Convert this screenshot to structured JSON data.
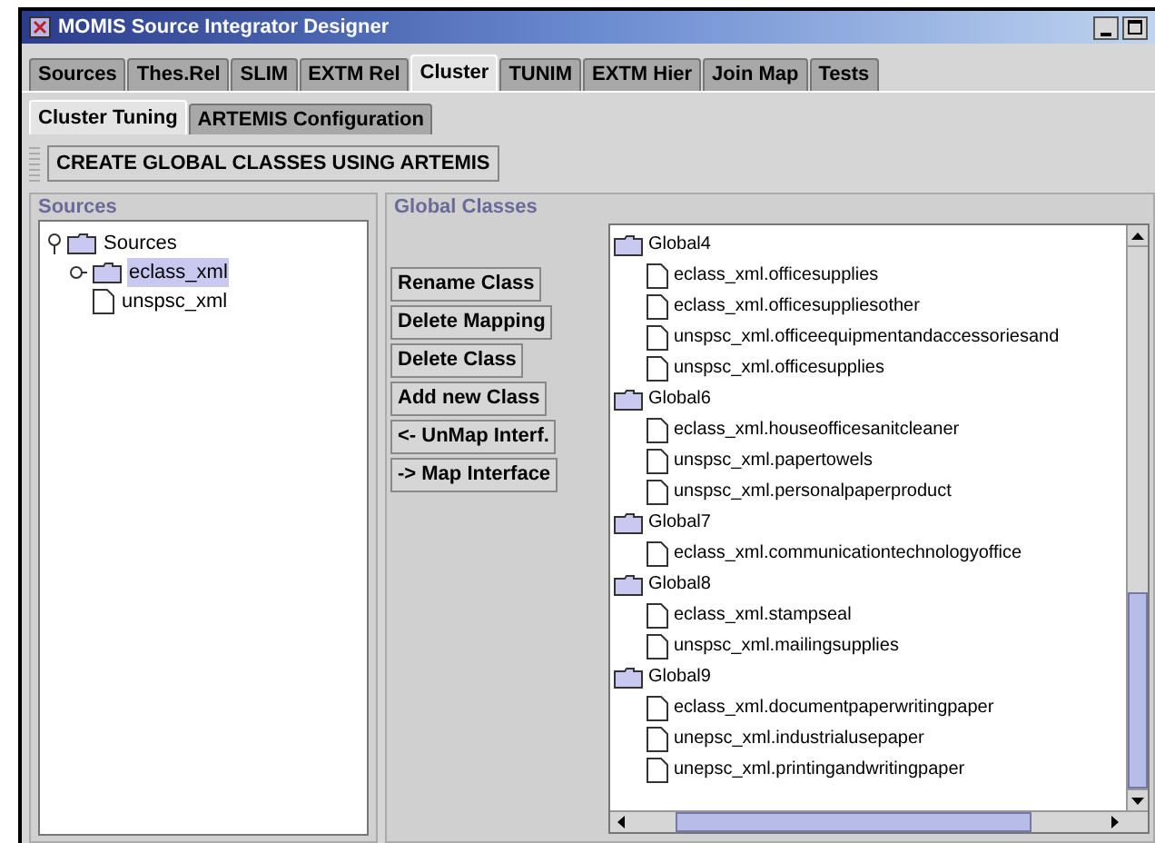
{
  "window": {
    "title": "MOMIS Source Integrator Designer"
  },
  "tabs": [
    {
      "label": "Sources",
      "selected": false
    },
    {
      "label": "Thes.Rel",
      "selected": false
    },
    {
      "label": "SLIM",
      "selected": false
    },
    {
      "label": "EXTM Rel",
      "selected": false
    },
    {
      "label": "Cluster",
      "selected": true
    },
    {
      "label": "TUNIM",
      "selected": false
    },
    {
      "label": "EXTM Hier",
      "selected": false
    },
    {
      "label": "Join Map",
      "selected": false
    },
    {
      "label": "Tests",
      "selected": false
    }
  ],
  "subtabs": [
    {
      "label": "Cluster Tuning",
      "selected": true
    },
    {
      "label": "ARTEMIS Configuration",
      "selected": false
    }
  ],
  "toolbar": {
    "button": "CREATE GLOBAL CLASSES USING ARTEMIS"
  },
  "sources_panel": {
    "title": "Sources",
    "tree": [
      {
        "label": "Sources",
        "expanded": true,
        "selected": false,
        "children": [
          {
            "label": "eclass_xml",
            "kind": "folder",
            "selected": true
          },
          {
            "label": "unspsc_xml",
            "kind": "file",
            "selected": false
          }
        ]
      }
    ]
  },
  "global_panel": {
    "title": "Global Classes",
    "buttons": [
      "Rename Class",
      "Delete Mapping",
      "Delete Class",
      "Add new Class",
      "<- UnMap Interf.",
      "-> Map Interface"
    ],
    "tree": [
      {
        "label": "Global4",
        "children": [
          "eclass_xml.officesupplies",
          "eclass_xml.officesuppliesother",
          "unspsc_xml.officeequipmentandaccessoriesand",
          "unspsc_xml.officesupplies"
        ]
      },
      {
        "label": "Global6",
        "children": [
          "eclass_xml.houseofficesanitcleaner",
          "unspsc_xml.papertowels",
          "unspsc_xml.personalpaperproduct"
        ]
      },
      {
        "label": "Global7",
        "children": [
          "eclass_xml.communicationtechnologyoffice"
        ]
      },
      {
        "label": "Global8",
        "children": [
          "eclass_xml.stampseal",
          "unspsc_xml.mailingsupplies"
        ]
      },
      {
        "label": "Global9",
        "children": [
          "eclass_xml.documentpaperwritingpaper",
          "unepsc_xml.industrialusepaper",
          "unepsc_xml.printingandwritingpaper"
        ]
      }
    ]
  }
}
